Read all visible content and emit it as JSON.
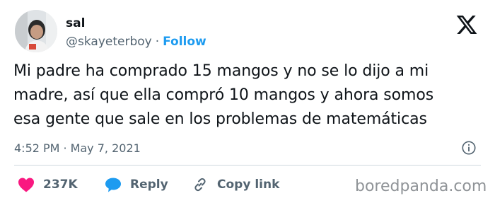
{
  "author": {
    "name": "sal",
    "handle": "@skayeterboy",
    "separator": "·",
    "follow_label": "Follow"
  },
  "tweet": {
    "lines": [
      "Mi padre ha comprado 15 mangos y no se lo dijo a mi",
      "madre, así que ella compró 10 mangos y ahora somos",
      "esa gente que sale en los problemas de matemáticas"
    ],
    "time": "4:52 PM",
    "separator": "·",
    "date": "May 7, 2021"
  },
  "actions": {
    "likes_count": "237K",
    "reply_label": "Reply",
    "copy_link_label": "Copy link"
  },
  "watermark": "boredpanda.com",
  "icons": {
    "platform": "x-logo-icon",
    "info": "info-icon",
    "like": "heart-icon",
    "reply": "speech-bubble-icon",
    "copy": "link-icon"
  },
  "colors": {
    "like": "#f91880",
    "reply": "#1d9bf0",
    "follow": "#1d9bf0",
    "secondary_text": "#536471"
  }
}
